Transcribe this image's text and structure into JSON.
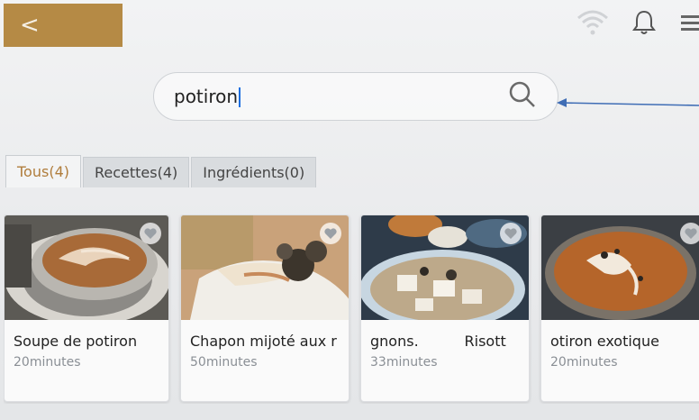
{
  "header": {
    "back_symbol": "<"
  },
  "search": {
    "query": "potiron"
  },
  "tabs": [
    {
      "label": "Tous(4)"
    },
    {
      "label": "Recettes(4)"
    },
    {
      "label": "Ingrédients(0)"
    }
  ],
  "cards": [
    {
      "title": "Soupe de potiron",
      "time": "20minutes"
    },
    {
      "title": "Chapon mijoté aux r",
      "time": "50minutes"
    },
    {
      "title": "gnons.          Risott",
      "time": "33minutes"
    },
    {
      "title": "otiron exotique",
      "time": "20minutes"
    }
  ],
  "colors": {
    "accent": "#b58a45",
    "active_tab_text": "#b07d3c",
    "arrow": "#3f6db5"
  },
  "icons": [
    "back-icon",
    "wifi-icon",
    "bell-icon",
    "menu-icon",
    "search-icon",
    "favorite-icon"
  ]
}
